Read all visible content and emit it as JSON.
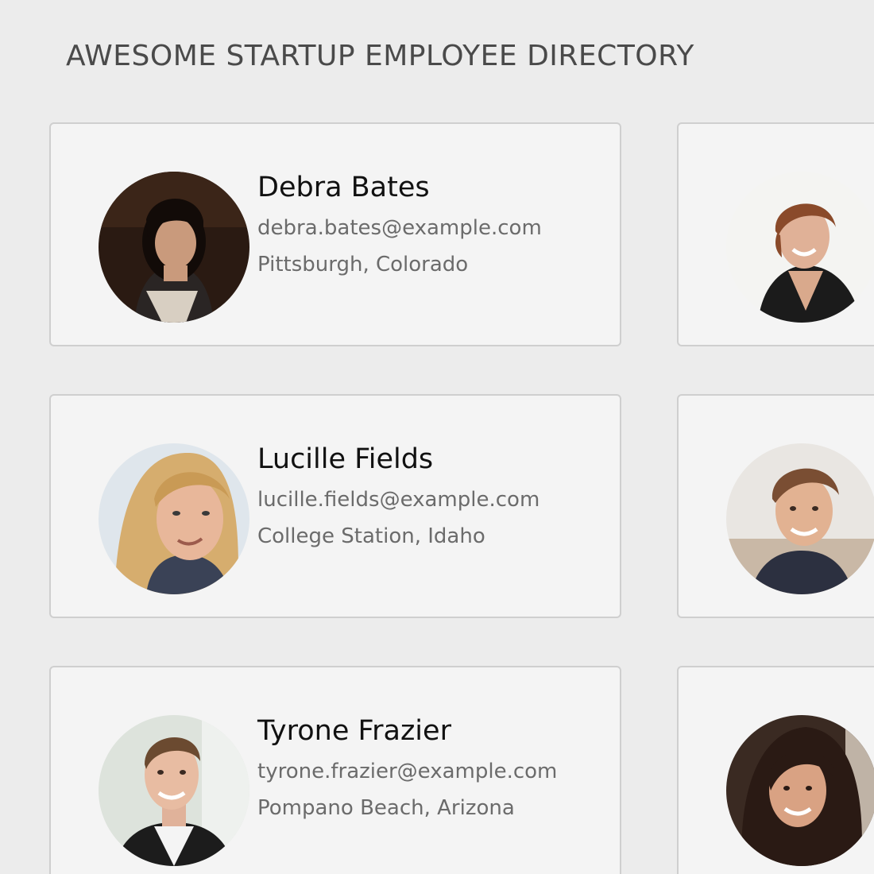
{
  "header": {
    "title": "AWESOME STARTUP EMPLOYEE DIRECTORY"
  },
  "employees": [
    {
      "name": "Debra Bates",
      "email": "debra.bates@example.com",
      "location": "Pittsburgh, Colorado"
    },
    {
      "name": "",
      "email": "",
      "location": ""
    },
    {
      "name": "Lucille Fields",
      "email": "lucille.fields@example.com",
      "location": "College Station, Idaho"
    },
    {
      "name": "",
      "email": "",
      "location": ""
    },
    {
      "name": "Tyrone Frazier",
      "email": "tyrone.frazier@example.com",
      "location": "Pompano Beach, Arizona"
    },
    {
      "name": "",
      "email": "",
      "location": ""
    }
  ],
  "colors": {
    "background": "#ececec",
    "card": "#f4f4f4",
    "card_border": "#cfcfcf",
    "name_text": "#111111",
    "detail_text": "#6b6b6b",
    "title_text": "#4a4a4a"
  }
}
